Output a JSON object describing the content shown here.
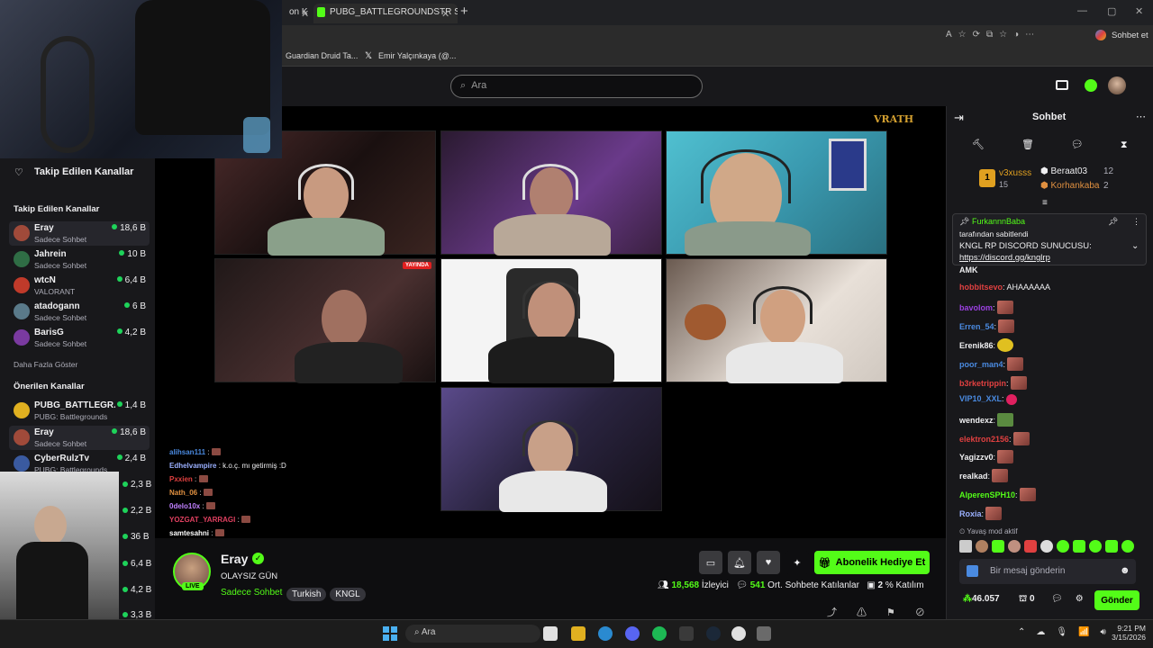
{
  "browser": {
    "tabs": [
      "on K",
      "PUBG_BATTLEGROUNDSTR Stream"
    ],
    "address_actions": [
      "Sohbet et"
    ],
    "bookmarks": [
      "Guardian Druid Ta...",
      "Emir Yalçınkaya (@..."
    ]
  },
  "nav": {
    "search_placeholder": "Ara"
  },
  "sidebar": {
    "header": "Takip Edilen Kanallar",
    "followed_title": "Takip Edilen Kanallar",
    "followed": [
      {
        "name": "Eray",
        "game": "Sadece Sohbet",
        "viewers": "18,6 B",
        "color": "#a04a3a"
      },
      {
        "name": "Jahrein",
        "game": "Sadece Sohbet",
        "viewers": "10 B",
        "color": "#2f6d45"
      },
      {
        "name": "wtcN",
        "game": "VALORANT",
        "viewers": "6,4 B",
        "color": "#c03a2a"
      },
      {
        "name": "atadogann",
        "game": "Sadece Sohbet",
        "viewers": "6 B",
        "color": "#5a7a8a"
      },
      {
        "name": "BarisG",
        "game": "Sadece Sohbet",
        "viewers": "4,2 B",
        "color": "#7a3aa0"
      }
    ],
    "show_more": "Daha Fazla Göster",
    "recommended_title": "Önerilen Kanallar",
    "recommended": [
      {
        "name": "PUBG_BATTLEGR...",
        "game": "PUBG: Battlegrounds",
        "viewers": "1,4 B",
        "color": "#e0b020"
      },
      {
        "name": "Eray",
        "game": "Sadece Sohbet",
        "viewers": "18,6 B",
        "color": "#a04a3a"
      },
      {
        "name": "CyberRulzTv",
        "game": "PUBG: Battlegrounds",
        "viewers": "2,4 B",
        "color": "#3a5aa0"
      }
    ],
    "extra_counts": [
      "2,3 B",
      "2,2 B",
      "36 B",
      "6,4 B",
      "4,2 B",
      "3,3 B"
    ]
  },
  "overlay_chat": [
    {
      "user": "alihsan111",
      "text": ":",
      "color": "#4a8ae0"
    },
    {
      "user": "Edhelvampire",
      "text": ": k.o.ç. mı getirmiş :D",
      "color": "#9ab0ff"
    },
    {
      "user": "Pxxien",
      "text": ":",
      "color": "#e04040"
    },
    {
      "user": "Nath_06",
      "text": ":",
      "color": "#e09040"
    },
    {
      "user": "0delo10x",
      "text": ":",
      "color": "#c080ff"
    },
    {
      "user": "YOZGAT_YARRAGI",
      "text": ":",
      "color": "#e04060"
    },
    {
      "user": "samtesahni",
      "text": ":",
      "color": "#ffffff"
    }
  ],
  "player": {
    "live_badge": "YAYINDA",
    "watermark": "VRATH"
  },
  "stream": {
    "channel": "Eray",
    "title": "OLAYSIZ GÜN",
    "category": "Sadece Sohbet",
    "tags": [
      "Turkish",
      "KNGL"
    ],
    "live": "LIVE",
    "subscribe_gift": "Abonelik Hediye Et",
    "viewers": "18,568",
    "viewers_label": "İzleyici",
    "chatters": "541",
    "chatters_label": "Ort. Sohbete Katılanlar",
    "participation": "2",
    "participation_label": "% Katılım"
  },
  "chat": {
    "title": "Sohbet",
    "leaderboard": [
      {
        "name": "v3xusss",
        "score": "15",
        "rank": "1"
      },
      {
        "name": "Beraat03",
        "score": "12"
      },
      {
        "name": "Korhankaba",
        "score": "2"
      }
    ],
    "pinned_by": "FurkannnBaba",
    "pinned_note": "tarafından sabitlendi",
    "pinned_text": "KNGL RP DISCORD SUNUCUSU:",
    "pinned_link": "https://discord.gg/knglrp",
    "messages": [
      {
        "user": "AMK",
        "text": "",
        "color": "#efeff1"
      },
      {
        "user": "hobbitsevo",
        "text": ": AHAAAAAA",
        "color": "#e04040"
      },
      {
        "user": "bavolom",
        "text": ":",
        "color": "#9a40e0"
      },
      {
        "user": "Erren_54",
        "text": ":",
        "color": "#4a8ae0"
      },
      {
        "user": "Erenik86",
        "text": ":",
        "color": "#efeff1"
      },
      {
        "user": "poor_man4",
        "text": ":",
        "color": "#4a8ae0"
      },
      {
        "user": "b3rketrippin",
        "text": ":",
        "color": "#e04040"
      },
      {
        "user": "VIP10_XXL",
        "text": ":",
        "color": "#4a8ae0"
      },
      {
        "user": "wendexz",
        "text": ":",
        "color": "#efeff1"
      },
      {
        "user": "elektron2156",
        "text": ":",
        "color": "#e04040"
      },
      {
        "user": "Yagizzv0",
        "text": ":",
        "color": "#efeff1"
      },
      {
        "user": "realkad",
        "text": ":",
        "color": "#efeff1"
      },
      {
        "user": "AlperenSPH10",
        "text": ":",
        "color": "#53fc18"
      },
      {
        "user": "Roxia",
        "text": ":",
        "color": "#9ab0ff"
      }
    ],
    "slow_mode": "Yavaş mod aktif",
    "input_placeholder": "Bir mesaj gönderin",
    "points": "46.057",
    "gifts": "0",
    "send": "Gönder"
  },
  "taskbar": {
    "search": "Ara",
    "time": "9:21 PM",
    "date": "3/15/2026"
  },
  "colors": {
    "accent": "#53fc18",
    "bg": "#0e0e10",
    "panel": "#18181b"
  }
}
